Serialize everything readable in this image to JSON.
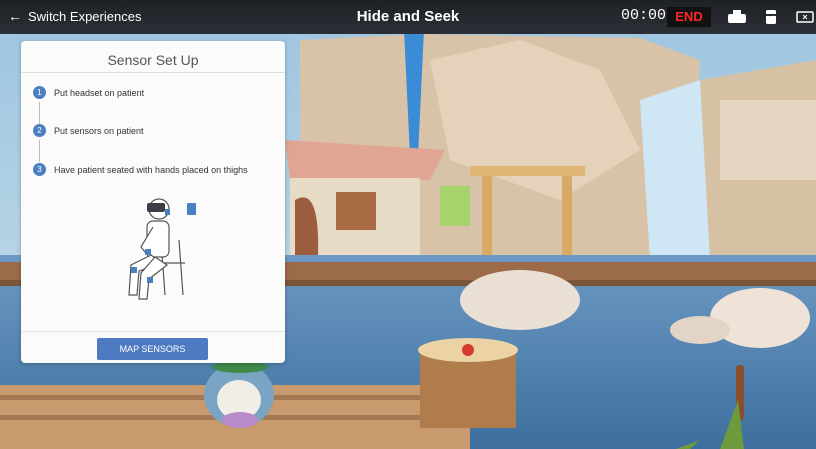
{
  "header": {
    "back_label": "Switch Experiences",
    "title": "Hide and Seek",
    "timer": "00:00",
    "end_label": "END",
    "icons": [
      "headset-icon",
      "sensor-icon",
      "screen-cast-icon"
    ]
  },
  "panel": {
    "title": "Sensor Set Up",
    "steps": [
      {
        "num": "1",
        "text": "Put headset on patient"
      },
      {
        "num": "2",
        "text": "Put sensors on patient"
      },
      {
        "num": "3",
        "text": "Have patient seated with hands placed on thighs"
      }
    ],
    "button_label": "MAP SENSORS"
  },
  "colors": {
    "accent": "#4d7ac0",
    "end_text": "#ff2727",
    "topbar": "#22262b"
  }
}
